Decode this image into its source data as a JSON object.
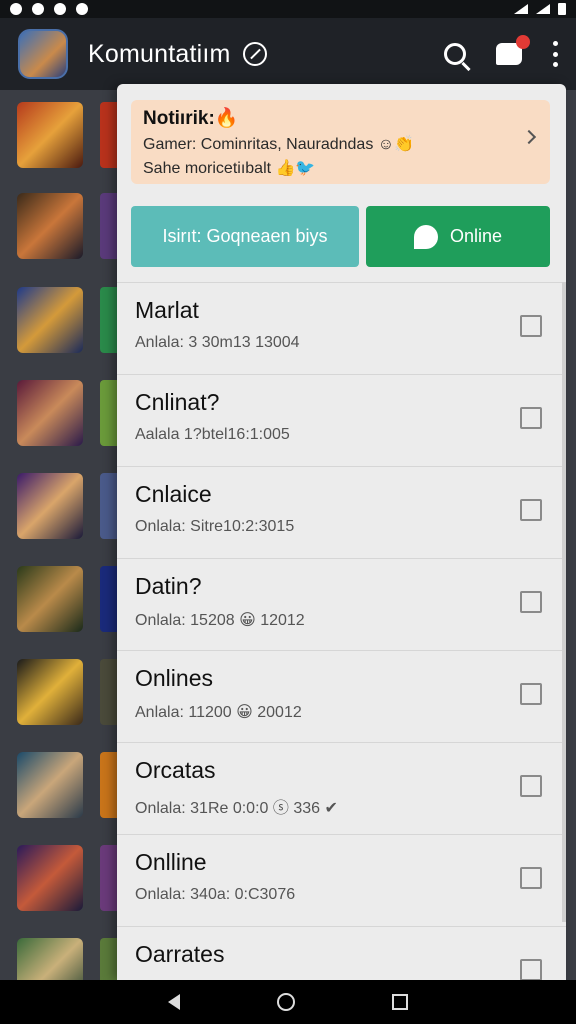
{
  "app_bar": {
    "title": "Komuntatiım",
    "icons": [
      "avatar",
      "verified-icon",
      "search-icon",
      "chat-icon",
      "more-vert-icon"
    ]
  },
  "notification": {
    "title": "Notiırik:🔥",
    "line1": "Gamer: Cominritas, Nauradndas ☺👏",
    "line2": "Sahe moricetiıbalt 👍🐦"
  },
  "buttons": {
    "left_label": "Isirıt: Goqneaen biys",
    "right_label": "Online"
  },
  "rows": [
    {
      "title": "Marlat",
      "subtitle": "Anlala: 3 30m13 13004"
    },
    {
      "title": "Cnlinat?",
      "subtitle": "Aalala 1?btel16:1:005"
    },
    {
      "title": "Cnlaice",
      "subtitle": "Onlala: Sitre10:2:3015"
    },
    {
      "title": "Datin?",
      "subtitle": "Onlala: 15208 😀 12012"
    },
    {
      "title": "Onlines",
      "subtitle": "Anlala: 11200 😀 20012"
    },
    {
      "title": "Orcatas",
      "subtitle": "Onlala: 31Re 0:0:0 ⓢ 336 ✔"
    },
    {
      "title": "Onlline",
      "subtitle": "Onlala: 340a: 0:C3076"
    },
    {
      "title": "Oarrates",
      "subtitle": ""
    }
  ],
  "colors": {
    "notification_bg": "#f9dcc4",
    "teal_button": "#5cbcb8",
    "green_button": "#1f9e5b",
    "app_bar": "#1f2227",
    "red_badge": "#e23a35"
  }
}
